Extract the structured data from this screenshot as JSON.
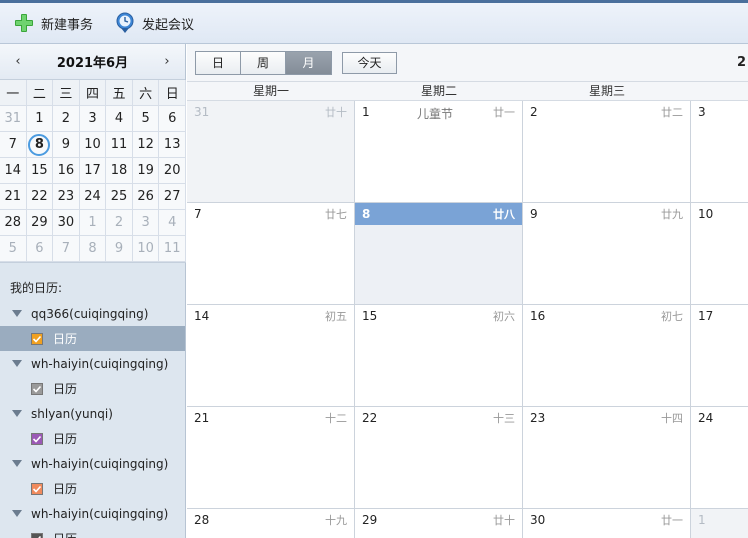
{
  "toolbar": {
    "new_task_label": "新建事务",
    "meeting_label": "发起会议"
  },
  "mini_calendar": {
    "title": "2021年6月",
    "prev": "‹",
    "next": "›",
    "dow": [
      "一",
      "二",
      "三",
      "四",
      "五",
      "六",
      "日"
    ],
    "days": [
      {
        "d": "31",
        "out": true
      },
      {
        "d": "1"
      },
      {
        "d": "2"
      },
      {
        "d": "3"
      },
      {
        "d": "4"
      },
      {
        "d": "5"
      },
      {
        "d": "6"
      },
      {
        "d": "7"
      },
      {
        "d": "8",
        "today": true
      },
      {
        "d": "9"
      },
      {
        "d": "10"
      },
      {
        "d": "11"
      },
      {
        "d": "12"
      },
      {
        "d": "13"
      },
      {
        "d": "14"
      },
      {
        "d": "15"
      },
      {
        "d": "16"
      },
      {
        "d": "17"
      },
      {
        "d": "18"
      },
      {
        "d": "19"
      },
      {
        "d": "20"
      },
      {
        "d": "21"
      },
      {
        "d": "22"
      },
      {
        "d": "23"
      },
      {
        "d": "24"
      },
      {
        "d": "25"
      },
      {
        "d": "26"
      },
      {
        "d": "27"
      },
      {
        "d": "28"
      },
      {
        "d": "29"
      },
      {
        "d": "30"
      },
      {
        "d": "1",
        "out": true
      },
      {
        "d": "2",
        "out": true
      },
      {
        "d": "3",
        "out": true
      },
      {
        "d": "4",
        "out": true
      },
      {
        "d": "5",
        "out": true
      },
      {
        "d": "6",
        "out": true
      },
      {
        "d": "7",
        "out": true
      },
      {
        "d": "8",
        "out": true
      },
      {
        "d": "9",
        "out": true
      },
      {
        "d": "10",
        "out": true
      },
      {
        "d": "11",
        "out": true
      }
    ]
  },
  "my_calendars": {
    "label": "我的日历:",
    "accounts": [
      {
        "name": "qq366(cuiqingqing)",
        "calendar": "日历",
        "color": "#f0a020",
        "selected": true
      },
      {
        "name": "wh-haiyin(cuiqingqing)",
        "calendar": "日历",
        "color": "#9a9a9a",
        "selected": false
      },
      {
        "name": "shlyan(yunqi)",
        "calendar": "日历",
        "color": "#9b59b6",
        "selected": false
      },
      {
        "name": "wh-haiyin(cuiqingqing)",
        "calendar": "日历",
        "color": "#f08a5d",
        "selected": false
      },
      {
        "name": "wh-haiyin(cuiqingqing)",
        "calendar": "日历",
        "color": "#555555",
        "selected": false
      }
    ]
  },
  "view": {
    "day": "日",
    "week": "周",
    "month": "月",
    "today": "今天",
    "year_fragment": "2"
  },
  "month_view": {
    "dow": [
      "星期一",
      "星期二",
      "星期三",
      ""
    ],
    "weeks": [
      [
        {
          "d": "31",
          "lunar": "廿十",
          "out": true
        },
        {
          "d": "1",
          "lunar": "廿一",
          "holiday": "儿童节"
        },
        {
          "d": "2",
          "lunar": "廿二"
        },
        {
          "d": "3",
          "lunar": ""
        }
      ],
      [
        {
          "d": "7",
          "lunar": "廿七"
        },
        {
          "d": "8",
          "lunar": "廿八",
          "today": true
        },
        {
          "d": "9",
          "lunar": "廿九"
        },
        {
          "d": "10",
          "lunar": ""
        }
      ],
      [
        {
          "d": "14",
          "lunar": "初五"
        },
        {
          "d": "15",
          "lunar": "初六"
        },
        {
          "d": "16",
          "lunar": "初七"
        },
        {
          "d": "17",
          "lunar": ""
        }
      ],
      [
        {
          "d": "21",
          "lunar": "十二"
        },
        {
          "d": "22",
          "lunar": "十三"
        },
        {
          "d": "23",
          "lunar": "十四"
        },
        {
          "d": "24",
          "lunar": ""
        }
      ],
      [
        {
          "d": "28",
          "lunar": "十九"
        },
        {
          "d": "29",
          "lunar": "廿十"
        },
        {
          "d": "30",
          "lunar": "廿一"
        },
        {
          "d": "1",
          "lunar": "",
          "out": true
        }
      ]
    ]
  }
}
